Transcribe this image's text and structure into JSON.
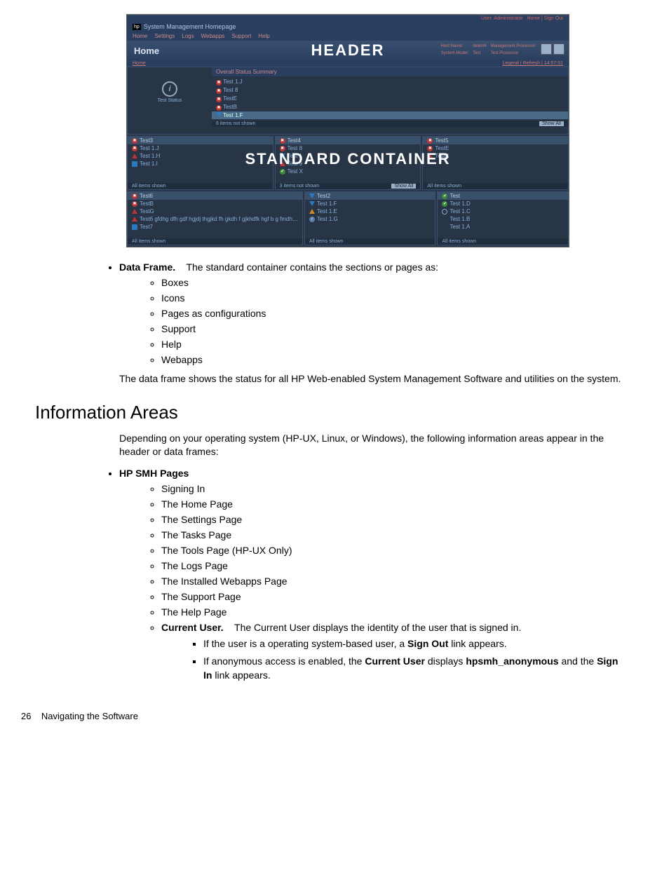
{
  "screenshot": {
    "app_title": "System Management Homepage",
    "user_label": "User: Administrator",
    "user_links": "Home | Sign Out",
    "nav": [
      "Home",
      "Settings",
      "Logs",
      "Webapps",
      "Support",
      "Help"
    ],
    "home_label": "Home",
    "header_overlay": "HEADER",
    "sysinfo": {
      "host_name_label": "Host Name:",
      "host_name": "itetest4",
      "sys_model_label": "System Model:",
      "sys_model": "Test",
      "mgmt_proc_label": "Management Processor:",
      "mgmt_proc": "Test Processor"
    },
    "crumb": "Home",
    "legend": "Legend",
    "refresh": "Refresh",
    "time": "14:57:51",
    "test_status_label": "Test Status",
    "summary_title": "Overall Status Summary",
    "summary_items": [
      "Test 1.J",
      "Test 8",
      "TestE",
      "TestB",
      "Test 1.F"
    ],
    "summary_footer": "6 items not shown",
    "show_all": "Show All",
    "container_overlay": "STANDARD CONTAINER",
    "row1": [
      {
        "title": "Test3",
        "items": [
          "Test 1.J",
          "Test 1.H",
          "Test 1.I"
        ],
        "footer": "All items shown"
      },
      {
        "title": "Test4",
        "items": [
          "Test 8",
          "Test 1",
          "Test 9",
          "Test X"
        ],
        "footer": "3 items not shown",
        "show_all": "Show All"
      },
      {
        "title": "Test5",
        "items": [
          "TestE",
          "TestK"
        ],
        "footer": "All items shown"
      }
    ],
    "row2": [
      {
        "title": "Test6",
        "items": [
          "TestB",
          "TestG",
          "Test6 gfdhg dfh gdf hgjdj thgjkd fh gkdh f gjkhdfk hgf b g fmdh…",
          "Test7"
        ],
        "footer": "All items shown"
      },
      {
        "title": "Test2",
        "items": [
          "Test 1.F",
          "Test 1.E",
          "Test 1.G"
        ],
        "footer": "All items shown"
      },
      {
        "title": "Test",
        "items": [
          "Test 1.D",
          "Test 1.C",
          "Test 1.B",
          "Test 1.A"
        ],
        "footer": "All items shown"
      }
    ]
  },
  "doc": {
    "data_frame_label": "Data Frame.",
    "data_frame_text": "The standard container contains the sections or pages as:",
    "data_frame_items": [
      "Boxes",
      "Icons",
      "Pages as configurations",
      "Support",
      "Help",
      "Webapps"
    ],
    "data_frame_para": "The data frame shows the status for all HP Web-enabled System Management Software and utilities on the system.",
    "heading": "Information Areas",
    "intro": "Depending on your operating system (HP-UX, Linux, or Windows), the following information areas appear in the header or data frames:",
    "smh_label": "HP SMH Pages",
    "smh_items": [
      "Signing In",
      "The Home Page",
      "The Settings Page",
      "The Tasks Page",
      "The Tools Page (HP-UX Only)",
      "The Logs Page",
      "The Installed Webapps Page",
      "The Support Page",
      "The Help Page"
    ],
    "current_user_label": "Current User.",
    "current_user_text": "The Current User displays the identity of the user that is signed in.",
    "cu_sub1_a": "If the user is a operating system-based user, a ",
    "cu_sub1_b": "Sign Out",
    "cu_sub1_c": " link appears.",
    "cu_sub2_a": "If anonymous access is enabled, the ",
    "cu_sub2_b": "Current User",
    "cu_sub2_c": " displays ",
    "cu_sub2_d": "hpsmh_anonymous",
    "cu_sub2_e": " and the ",
    "cu_sub2_f": "Sign In",
    "cu_sub2_g": " link appears.",
    "page_num": "26",
    "page_title": "Navigating the Software"
  }
}
